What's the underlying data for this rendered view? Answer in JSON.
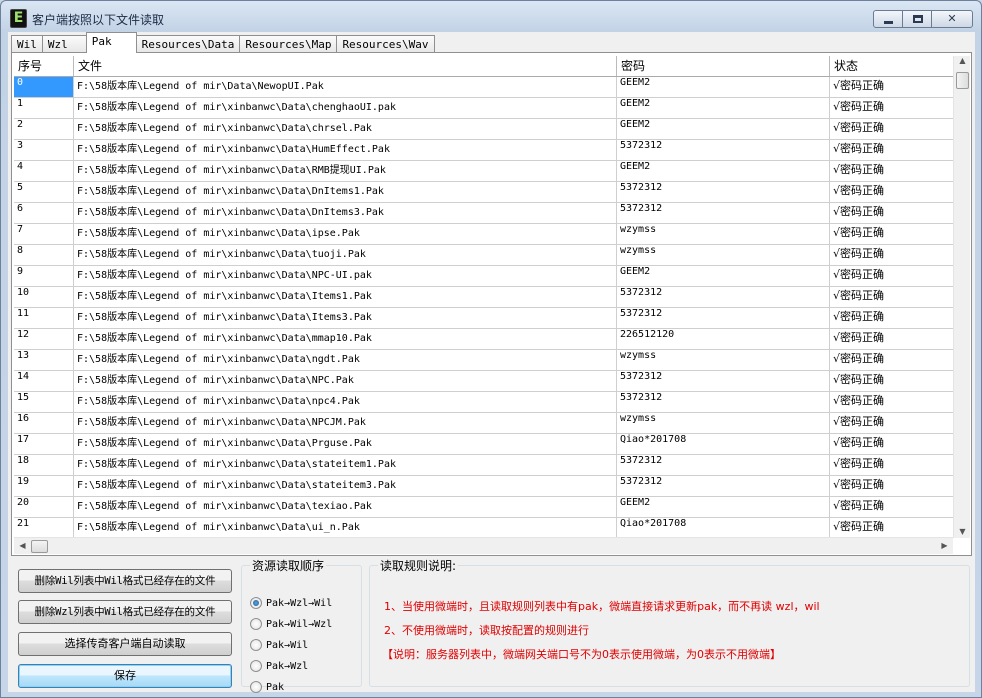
{
  "window": {
    "icon_letter": "E",
    "title": "客户端按照以下文件读取",
    "minimize_label": "minimize",
    "maximize_label": "maximize",
    "close_glyph": "✕"
  },
  "tabs": [
    {
      "label": "Wil"
    },
    {
      "label": "Wzl"
    },
    {
      "label": "Pak",
      "active": true
    },
    {
      "label": "Resources\\Data"
    },
    {
      "label": "Resources\\Map"
    },
    {
      "label": "Resources\\Wav"
    }
  ],
  "grid": {
    "columns": [
      "序号",
      "文件",
      "密码",
      "状态"
    ],
    "rows": [
      {
        "id": "0",
        "file": "F:\\58版本库\\Legend of mir\\Data\\NewopUI.Pak",
        "password": "GEEM2",
        "status": "√密码正确"
      },
      {
        "id": "1",
        "file": "F:\\58版本库\\Legend of mir\\xinbanwc\\Data\\chenghaoUI.pak",
        "password": "GEEM2",
        "status": "√密码正确"
      },
      {
        "id": "2",
        "file": "F:\\58版本库\\Legend of mir\\xinbanwc\\Data\\chrsel.Pak",
        "password": "GEEM2",
        "status": "√密码正确"
      },
      {
        "id": "3",
        "file": "F:\\58版本库\\Legend of mir\\xinbanwc\\Data\\HumEffect.Pak",
        "password": "5372312",
        "status": "√密码正确"
      },
      {
        "id": "4",
        "file": "F:\\58版本库\\Legend of mir\\xinbanwc\\Data\\RMB提现UI.Pak",
        "password": "GEEM2",
        "status": "√密码正确"
      },
      {
        "id": "5",
        "file": "F:\\58版本库\\Legend of mir\\xinbanwc\\Data\\DnItems1.Pak",
        "password": "5372312",
        "status": "√密码正确"
      },
      {
        "id": "6",
        "file": "F:\\58版本库\\Legend of mir\\xinbanwc\\Data\\DnItems3.Pak",
        "password": "5372312",
        "status": "√密码正确"
      },
      {
        "id": "7",
        "file": "F:\\58版本库\\Legend of mir\\xinbanwc\\Data\\ipse.Pak",
        "password": "wzymss",
        "status": "√密码正确"
      },
      {
        "id": "8",
        "file": "F:\\58版本库\\Legend of mir\\xinbanwc\\Data\\tuoji.Pak",
        "password": "wzymss",
        "status": "√密码正确"
      },
      {
        "id": "9",
        "file": "F:\\58版本库\\Legend of mir\\xinbanwc\\Data\\NPC-UI.pak",
        "password": "GEEM2",
        "status": "√密码正确"
      },
      {
        "id": "10",
        "file": "F:\\58版本库\\Legend of mir\\xinbanwc\\Data\\Items1.Pak",
        "password": "5372312",
        "status": "√密码正确"
      },
      {
        "id": "11",
        "file": "F:\\58版本库\\Legend of mir\\xinbanwc\\Data\\Items3.Pak",
        "password": "5372312",
        "status": "√密码正确"
      },
      {
        "id": "12",
        "file": "F:\\58版本库\\Legend of mir\\xinbanwc\\Data\\mmap10.Pak",
        "password": "226512120",
        "status": "√密码正确"
      },
      {
        "id": "13",
        "file": "F:\\58版本库\\Legend of mir\\xinbanwc\\Data\\ngdt.Pak",
        "password": "wzymss",
        "status": "√密码正确"
      },
      {
        "id": "14",
        "file": "F:\\58版本库\\Legend of mir\\xinbanwc\\Data\\NPC.Pak",
        "password": "5372312",
        "status": "√密码正确"
      },
      {
        "id": "15",
        "file": "F:\\58版本库\\Legend of mir\\xinbanwc\\Data\\npc4.Pak",
        "password": "5372312",
        "status": "√密码正确"
      },
      {
        "id": "16",
        "file": "F:\\58版本库\\Legend of mir\\xinbanwc\\Data\\NPCJM.Pak",
        "password": "wzymss",
        "status": "√密码正确"
      },
      {
        "id": "17",
        "file": "F:\\58版本库\\Legend of mir\\xinbanwc\\Data\\Prguse.Pak",
        "password": "Qiao*201708",
        "status": "√密码正确"
      },
      {
        "id": "18",
        "file": "F:\\58版本库\\Legend of mir\\xinbanwc\\Data\\stateitem1.Pak",
        "password": "5372312",
        "status": "√密码正确"
      },
      {
        "id": "19",
        "file": "F:\\58版本库\\Legend of mir\\xinbanwc\\Data\\stateitem3.Pak",
        "password": "5372312",
        "status": "√密码正确"
      },
      {
        "id": "20",
        "file": "F:\\58版本库\\Legend of mir\\xinbanwc\\Data\\texiao.Pak",
        "password": "GEEM2",
        "status": "√密码正确"
      },
      {
        "id": "21",
        "file": "F:\\58版本库\\Legend of mir\\xinbanwc\\Data\\ui_n.Pak",
        "password": "Qiao*201708",
        "status": "√密码正确"
      }
    ]
  },
  "buttons": {
    "delete_wil": "删除Wil列表中Wil格式已经存在的文件",
    "delete_wzl": "删除Wzl列表中Wil格式已经存在的文件",
    "auto_read": "选择传奇客户端自动读取",
    "save": "保存"
  },
  "order_group": {
    "title": "资源读取顺序",
    "options": [
      {
        "label": "Pak→Wzl→Wil",
        "selected": true
      },
      {
        "label": "Pak→Wil→Wzl",
        "selected": false
      },
      {
        "label": "Pak→Wil",
        "selected": false
      },
      {
        "label": "Pak→Wzl",
        "selected": false
      },
      {
        "label": "Pak",
        "selected": false
      }
    ]
  },
  "rules_group": {
    "title": "读取规则说明:",
    "line1": "1、当使用微端时，且读取规则列表中有pak，微端直接请求更新pak，而不再读 wzl，wil",
    "line2": "2、不使用微端时，读取按配置的规则进行",
    "line3": "【说明：服务器列表中，微端网关端口号不为0表示使用微端，为0表示不用微端】"
  },
  "colors": {
    "selection": "#3399ff",
    "rule_text": "#e00000"
  }
}
